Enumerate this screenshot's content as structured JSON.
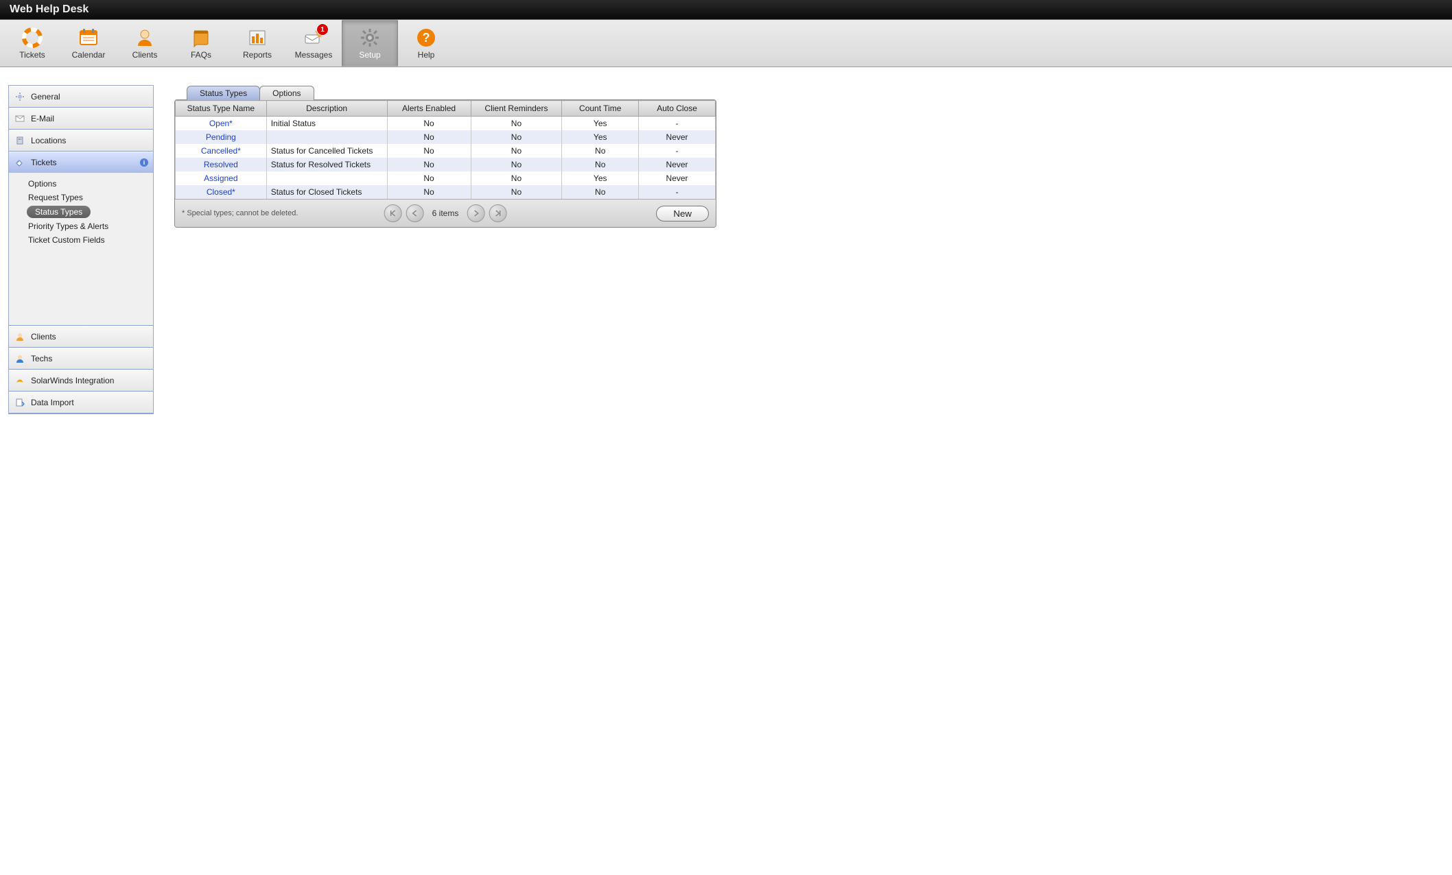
{
  "app_title": "Web Help Desk",
  "toolbar": [
    {
      "id": "tickets",
      "label": "Tickets"
    },
    {
      "id": "calendar",
      "label": "Calendar"
    },
    {
      "id": "clients",
      "label": "Clients"
    },
    {
      "id": "faqs",
      "label": "FAQs"
    },
    {
      "id": "reports",
      "label": "Reports"
    },
    {
      "id": "messages",
      "label": "Messages",
      "badge": "1"
    },
    {
      "id": "setup",
      "label": "Setup",
      "active": true
    },
    {
      "id": "help",
      "label": "Help"
    }
  ],
  "sidebar": {
    "sections": [
      {
        "id": "general",
        "label": "General"
      },
      {
        "id": "email",
        "label": "E-Mail"
      },
      {
        "id": "locations",
        "label": "Locations"
      },
      {
        "id": "tickets",
        "label": "Tickets",
        "selected": true,
        "info": true,
        "items": [
          {
            "label": "Options"
          },
          {
            "label": "Request Types"
          },
          {
            "label": "Status Types",
            "active": true
          },
          {
            "label": "Priority Types & Alerts"
          },
          {
            "label": "Ticket Custom Fields"
          }
        ]
      },
      {
        "id": "clients",
        "label": "Clients"
      },
      {
        "id": "techs",
        "label": "Techs"
      },
      {
        "id": "solarwinds",
        "label": "SolarWinds Integration"
      },
      {
        "id": "dataimport",
        "label": "Data Import"
      }
    ]
  },
  "tabs": [
    {
      "label": "Status Types",
      "active": true
    },
    {
      "label": "Options"
    }
  ],
  "table": {
    "columns": [
      "Status Type Name",
      "Description",
      "Alerts Enabled",
      "Client Reminders",
      "Count Time",
      "Auto Close"
    ],
    "rows": [
      {
        "name": "Open*",
        "desc": "Initial Status",
        "alerts": "No",
        "reminders": "No",
        "count": "Yes",
        "auto": "-"
      },
      {
        "name": "Pending",
        "desc": "",
        "alerts": "No",
        "reminders": "No",
        "count": "Yes",
        "auto": "Never"
      },
      {
        "name": "Cancelled*",
        "desc": "Status for Cancelled Tickets",
        "alerts": "No",
        "reminders": "No",
        "count": "No",
        "auto": "-"
      },
      {
        "name": "Resolved",
        "desc": "Status for Resolved Tickets",
        "alerts": "No",
        "reminders": "No",
        "count": "No",
        "auto": "Never"
      },
      {
        "name": "Assigned",
        "desc": "",
        "alerts": "No",
        "reminders": "No",
        "count": "Yes",
        "auto": "Never"
      },
      {
        "name": "Closed*",
        "desc": "Status for Closed Tickets",
        "alerts": "No",
        "reminders": "No",
        "count": "No",
        "auto": "-"
      }
    ]
  },
  "footer": {
    "note": "* Special types; cannot be deleted.",
    "count_label": "6 items",
    "new_label": "New"
  }
}
